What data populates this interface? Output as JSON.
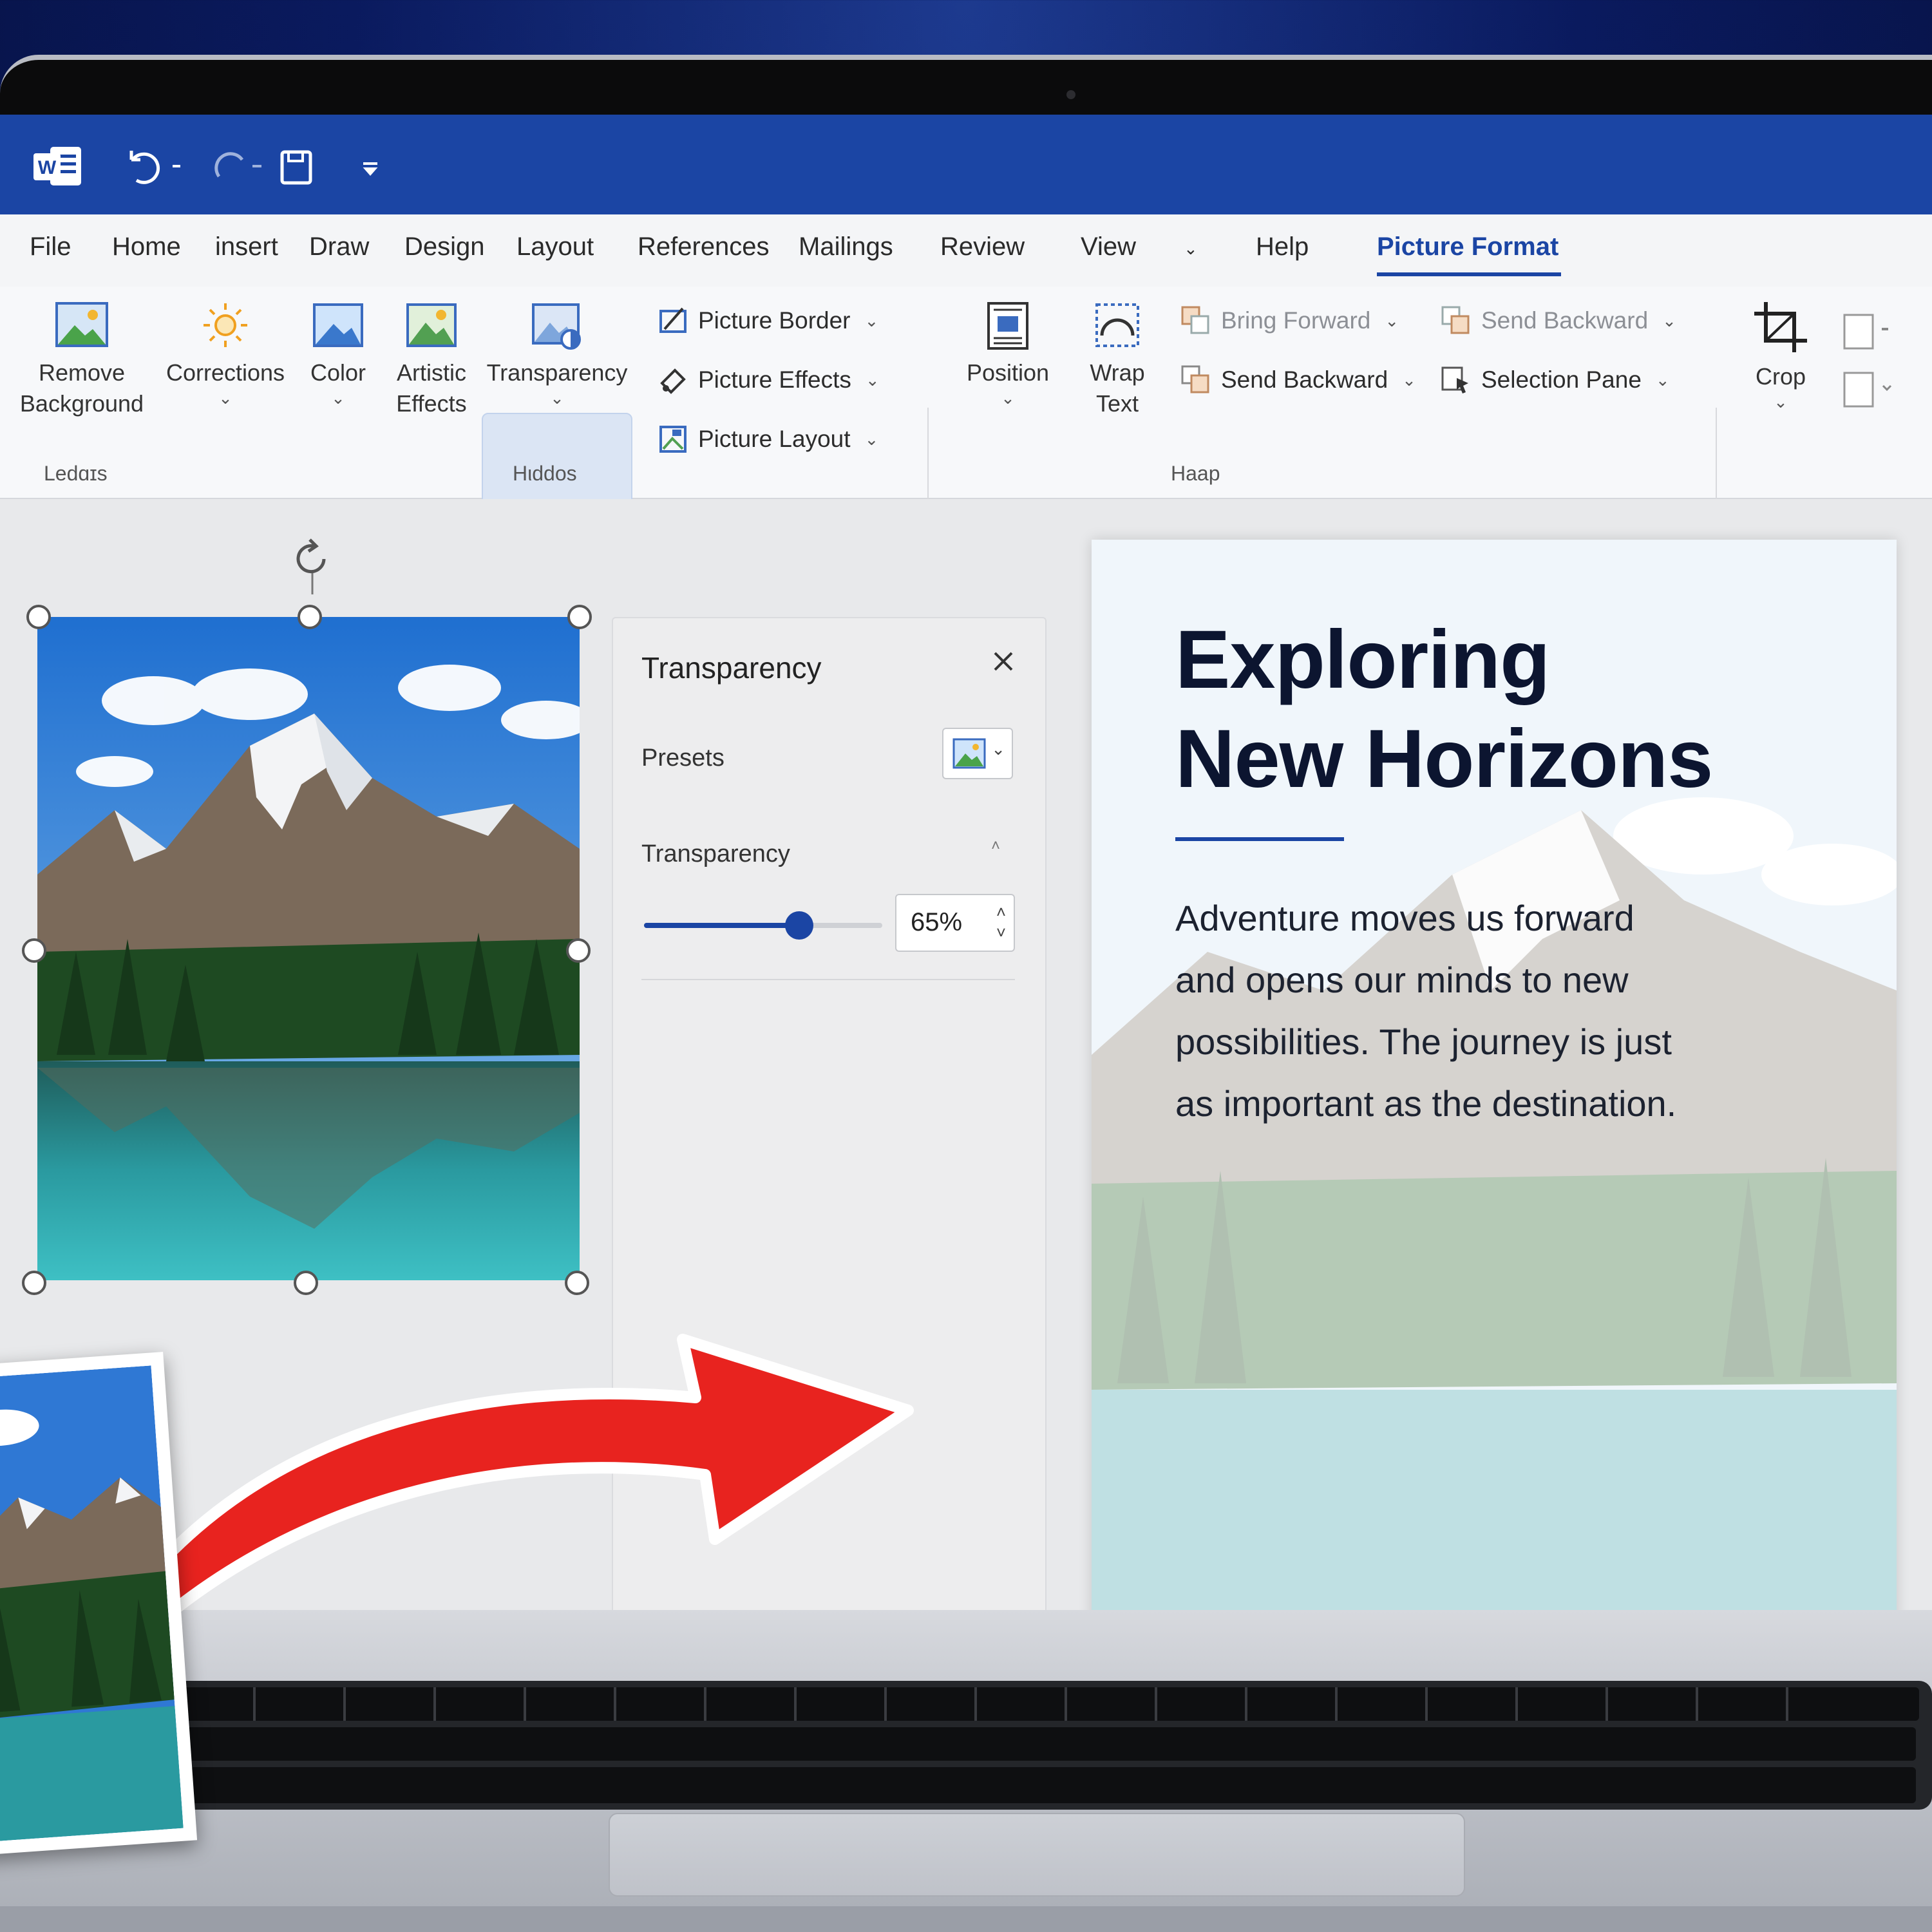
{
  "titlebar": {
    "app_icon": "word-icon",
    "quick_access": [
      "undo-icon",
      "redo-icon",
      "save-icon",
      "customize-icon"
    ]
  },
  "menu": {
    "tabs": [
      "File",
      "Home",
      "insert",
      "Draw",
      "Design",
      "Layout",
      "References",
      "Mailings",
      "Review",
      "View",
      "Help",
      "Picture Format"
    ],
    "active_tab": "Picture Format"
  },
  "ribbon": {
    "adjust": {
      "remove_background": [
        "Remove",
        "Background"
      ],
      "corrections": "Corrections",
      "color": "Color",
      "artistic_effects": [
        "Artistic",
        "Effects"
      ],
      "transparency": "Transparency",
      "group_label": "Ledɑɪs"
    },
    "styles": {
      "picture_border": "Picture Border",
      "picture_effects": "Picture Effects",
      "picture_layout": "Picture Layout",
      "group_label": "Ηιddos"
    },
    "arrange": {
      "position": "Position",
      "wrap_text": [
        "Wrap",
        "Text"
      ],
      "bring_forward": "Bring Forward",
      "send_backward_top": "Send Backward",
      "send_backward": "Send Backward",
      "selection_pane": "Selection Pane",
      "group_label": "Haap"
    },
    "size": {
      "crop": "Crop"
    }
  },
  "pane": {
    "title": "Transparency",
    "presets_label": "Presets",
    "transparency_label": "Transparency",
    "transparency_value": "65%",
    "transparency_level": 0.65
  },
  "document": {
    "title_line1": "Exploring",
    "title_line2": "New Horizons",
    "body": "Adventure moves us forward and opens our minds to new possibilities. The journey is just as important as the destination."
  },
  "colors": {
    "accent": "#1b45a4",
    "arrow": "#e8231f"
  }
}
